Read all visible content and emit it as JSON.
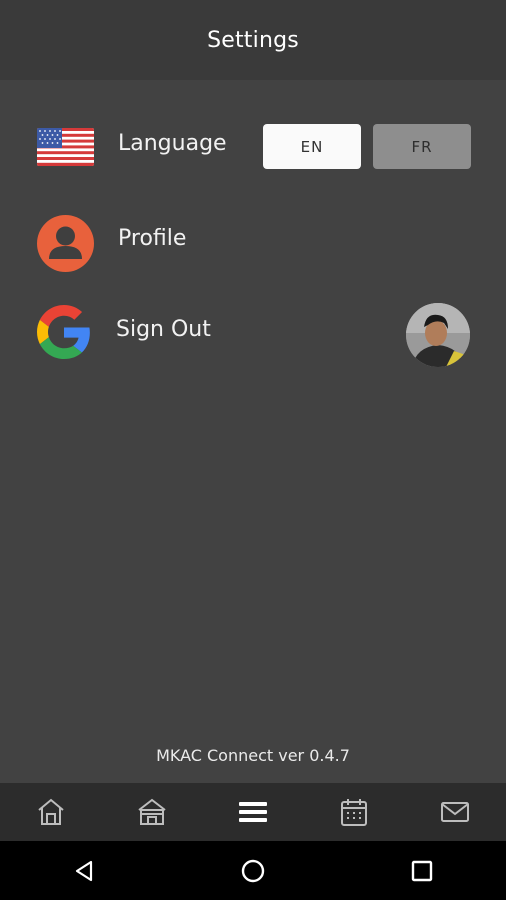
{
  "header": {
    "title": "Settings"
  },
  "settings": {
    "language": {
      "label": "Language",
      "options": {
        "en": "EN",
        "fr": "FR"
      },
      "selected": "EN"
    },
    "profile": {
      "label": "Profile"
    },
    "signout": {
      "label": "Sign Out"
    }
  },
  "footer": {
    "version": "MKAC Connect ver 0.4.7"
  },
  "tabs": [
    "home-icon",
    "shop-icon",
    "menu-icon",
    "calendar-icon",
    "mail-icon"
  ],
  "colors": {
    "background": "#424242",
    "header": "#3a3a3a",
    "profile_icon": "#e8613c",
    "tabbar": "#2c2c2c"
  }
}
